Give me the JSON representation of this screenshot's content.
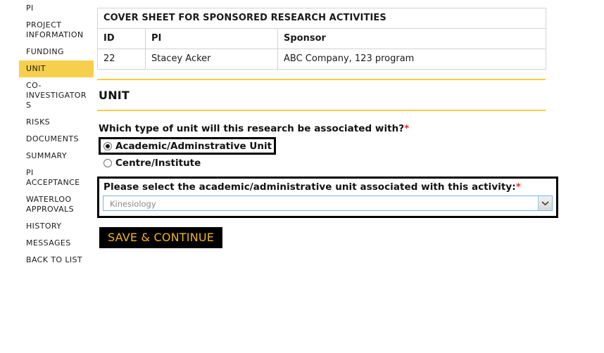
{
  "sidebar": {
    "items": [
      {
        "label": "PI",
        "active": false
      },
      {
        "label": "PROJECT INFORMATION",
        "active": false
      },
      {
        "label": "FUNDING",
        "active": false
      },
      {
        "label": "UNIT",
        "active": true
      },
      {
        "label": "CO-INVESTIGATORS",
        "active": false
      },
      {
        "label": "RISKS",
        "active": false
      },
      {
        "label": "DOCUMENTS",
        "active": false
      },
      {
        "label": "SUMMARY",
        "active": false
      },
      {
        "label": "PI ACCEPTANCE",
        "active": false
      },
      {
        "label": "WATERLOO APPROVALS",
        "active": false
      },
      {
        "label": "HISTORY",
        "active": false
      },
      {
        "label": "MESSAGES",
        "active": false
      },
      {
        "label": "BACK TO LIST",
        "active": false
      }
    ],
    "active_highlight_color": "#f6cf4c"
  },
  "cover_sheet": {
    "title": "COVER SHEET FOR SPONSORED RESEARCH ACTIVITIES",
    "columns": [
      "ID",
      "PI",
      "Sponsor"
    ],
    "row": {
      "id": "22",
      "pi": "Stacey Acker",
      "sponsor": "ABC Company, 123 program"
    }
  },
  "section": {
    "heading": "UNIT",
    "rule_color": "#f5ce3e"
  },
  "unit_form": {
    "question": "Which type of unit will this research be associated with?",
    "question_required_mark": "*",
    "options": [
      {
        "label": "Academic/Adminstrative Unit",
        "selected": true,
        "highlighted": true
      },
      {
        "label": "Centre/Institute",
        "selected": false,
        "highlighted": false
      }
    ],
    "select_label": "Please select the academic/administrative unit associated with this activity:",
    "select_required_mark": "*",
    "select_value": "Kinesiology",
    "select_arrow_icon": "chevron-down-icon",
    "save_label": "SAVE & CONTINUE",
    "save_text_color": "#f0b41e",
    "save_bg_color": "#000000",
    "required_color": "#e8302d"
  }
}
